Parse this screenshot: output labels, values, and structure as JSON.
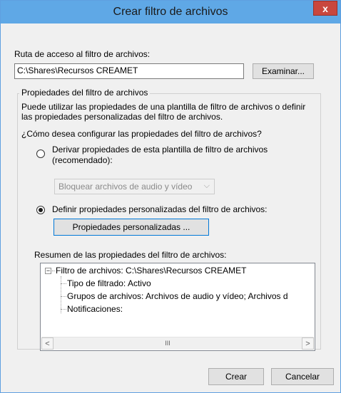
{
  "window": {
    "title": "Crear filtro de archivos",
    "close_label": "x"
  },
  "path": {
    "label": "Ruta de acceso al filtro de archivos:",
    "value": "C:\\Shares\\Recursos CREAMET",
    "browse_label": "Examinar..."
  },
  "properties": {
    "group_title": "Propiedades del filtro de archivos",
    "description_line1": "Puede utilizar las propiedades de una plantilla de filtro de archivos o definir",
    "description_line2": "las propiedades personalizadas del filtro de archivos.",
    "question": "¿Cómo desea configurar las propiedades del filtro de archivos?",
    "option_template_line1": "Derivar propiedades de esta plantilla de filtro de archivos",
    "option_template_line2": "(recomendado):",
    "option_template_checked": false,
    "template_select_value": "Bloquear archivos de audio y vídeo",
    "option_custom": "Definir propiedades personalizadas del filtro de archivos:",
    "option_custom_checked": true,
    "custom_button_label": "Propiedades personalizadas ..."
  },
  "summary": {
    "label": "Resumen de las propiedades del filtro de archivos:",
    "root": "Filtro de archivos: C:\\Shares\\Recursos CREAMET",
    "children": [
      "Tipo de filtrado: Activo",
      "Grupos de archivos: Archivos de audio y vídeo; Archivos d",
      "Notificaciones:"
    ],
    "scroll_left": "<",
    "scroll_grip": "III",
    "scroll_right": ">"
  },
  "footer": {
    "create_label": "Crear",
    "cancel_label": "Cancelar"
  },
  "colors": {
    "titlebar": "#5fa8e6",
    "close_button": "#c9473e"
  }
}
